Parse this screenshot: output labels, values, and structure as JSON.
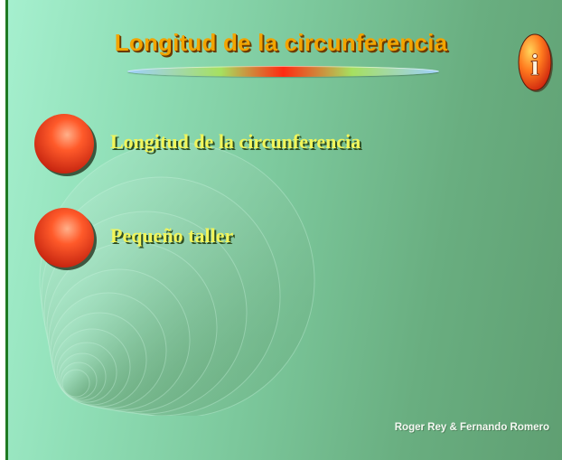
{
  "slide": {
    "title": "Longitud de la circunferencia",
    "info_button_glyph": "i",
    "menu": [
      {
        "label": "Longitud de la circunferencia",
        "icon": "red-sphere-bullet"
      },
      {
        "label": "Pequeño taller",
        "icon": "red-sphere-bullet"
      }
    ],
    "credits": "Roger Rey  &  Fernando Romero"
  },
  "colors": {
    "background_left": "#a6f0cf",
    "background_right": "#5f9f72",
    "title_orange": "#f3a400",
    "menu_text_yellow": "#f2f55a",
    "sphere_red": "#e8381a",
    "left_bar_green": "#1f7a23"
  }
}
